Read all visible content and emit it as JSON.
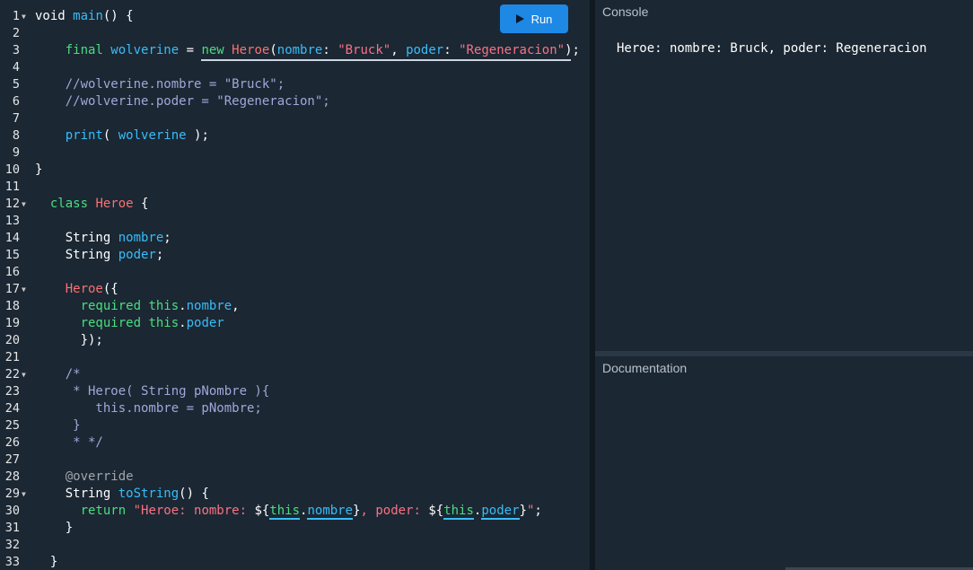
{
  "run_button": {
    "label": "Run"
  },
  "console": {
    "title": "Console",
    "output": "Heroe: nombre: Bruck, poder: Regeneracion"
  },
  "documentation": {
    "title": "Documentation"
  },
  "folds": [
    1,
    12,
    17,
    22,
    29
  ],
  "lines": [
    [
      [
        "void ",
        "plain"
      ],
      [
        "main",
        "fn"
      ],
      [
        "() {",
        "plain"
      ]
    ],
    [],
    [
      [
        "    ",
        "plain"
      ],
      [
        "final ",
        "kw"
      ],
      [
        "wolverine",
        "fn"
      ],
      [
        " = ",
        "plain"
      ],
      [
        "new ",
        "kw"
      ],
      [
        "Heroe",
        "class"
      ],
      [
        "(",
        "plain"
      ],
      [
        "nombre",
        "fn"
      ],
      [
        ": ",
        "plain"
      ],
      [
        "\"Bruck\"",
        "string"
      ],
      [
        ", ",
        "plain"
      ],
      [
        "poder",
        "fn"
      ],
      [
        ": ",
        "plain"
      ],
      [
        "\"Regeneracion\"",
        "string"
      ],
      [
        ");",
        "plain"
      ]
    ],
    [],
    [
      [
        "    //wolverine.nombre = \"Bruck\";",
        "comment"
      ]
    ],
    [
      [
        "    //wolverine.poder = \"Regeneracion\";",
        "comment"
      ]
    ],
    [],
    [
      [
        "    ",
        "plain"
      ],
      [
        "print",
        "fn"
      ],
      [
        "( ",
        "plain"
      ],
      [
        "wolverine",
        "fn"
      ],
      [
        " );",
        "plain"
      ]
    ],
    [],
    [
      [
        "}",
        "plain"
      ]
    ],
    [],
    [
      [
        "  ",
        "plain"
      ],
      [
        "class ",
        "kw"
      ],
      [
        "Heroe",
        "class"
      ],
      [
        " {",
        "plain"
      ]
    ],
    [],
    [
      [
        "    String ",
        "plain"
      ],
      [
        "nombre",
        "fn"
      ],
      [
        ";",
        "plain"
      ]
    ],
    [
      [
        "    String ",
        "plain"
      ],
      [
        "poder",
        "fn"
      ],
      [
        ";",
        "plain"
      ]
    ],
    [],
    [
      [
        "    ",
        "plain"
      ],
      [
        "Heroe",
        "class"
      ],
      [
        "({",
        "plain"
      ]
    ],
    [
      [
        "      ",
        "plain"
      ],
      [
        "required ",
        "kw"
      ],
      [
        "this",
        "kw"
      ],
      [
        ".",
        "plain"
      ],
      [
        "nombre",
        "fn"
      ],
      [
        ",",
        "plain"
      ]
    ],
    [
      [
        "      ",
        "plain"
      ],
      [
        "required ",
        "kw"
      ],
      [
        "this",
        "kw"
      ],
      [
        ".",
        "plain"
      ],
      [
        "poder",
        "fn"
      ]
    ],
    [
      [
        "      });",
        "plain"
      ]
    ],
    [],
    [
      [
        "    /*",
        "comment"
      ]
    ],
    [
      [
        "     * Heroe( String pNombre ){",
        "comment"
      ]
    ],
    [
      [
        "        this.nombre = pNombre;",
        "comment"
      ]
    ],
    [
      [
        "     }",
        "comment"
      ]
    ],
    [
      [
        "     * */",
        "comment"
      ]
    ],
    [],
    [
      [
        "    @override",
        "anno"
      ]
    ],
    [
      [
        "    String ",
        "plain"
      ],
      [
        "toString",
        "fn"
      ],
      [
        "() {",
        "plain"
      ]
    ],
    [
      [
        "      ",
        "plain"
      ],
      [
        "return ",
        "kw"
      ],
      [
        "\"Heroe: nombre: ",
        "string"
      ],
      [
        "${",
        "plain"
      ],
      [
        "this",
        "kw"
      ],
      [
        ".",
        "plain"
      ],
      [
        "nombre",
        "fn"
      ],
      [
        "}",
        "plain"
      ],
      [
        ", poder: ",
        "string"
      ],
      [
        "${",
        "plain"
      ],
      [
        "this",
        "kw"
      ],
      [
        ".",
        "plain"
      ],
      [
        "poder",
        "fn"
      ],
      [
        "}",
        "plain"
      ],
      [
        "\"",
        "string"
      ],
      [
        ";",
        "plain"
      ]
    ],
    [
      [
        "    }",
        "plain"
      ]
    ],
    [],
    [
      [
        "  }",
        "plain"
      ]
    ]
  ]
}
